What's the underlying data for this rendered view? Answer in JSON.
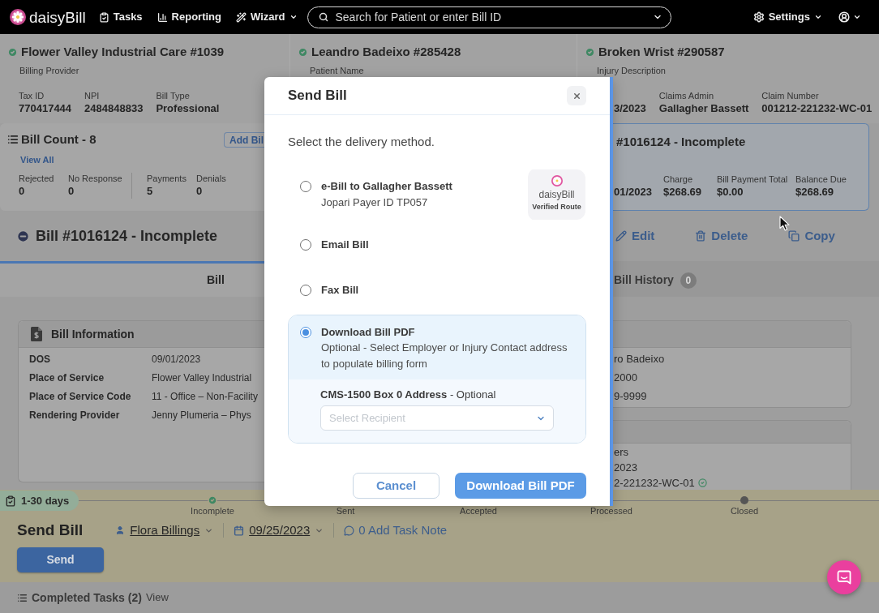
{
  "nav": {
    "logo": "daisy**Bill**",
    "items": [
      {
        "label": "Tasks",
        "menu": false
      },
      {
        "label": "Reporting",
        "menu": false
      },
      {
        "label": "Wizard",
        "menu": true
      }
    ],
    "search": {
      "placeholder": "Search for Patient or enter Bill ID"
    },
    "settings": {
      "label": "Settings",
      "menu": true
    },
    "account": {
      "menu": true
    }
  },
  "summary_cards": [
    {
      "title": "Flower Valley Industrial Care #1039",
      "subtitle": "Billing Provider",
      "fields": [
        {
          "label": "Tax ID",
          "value": "770417444"
        },
        {
          "label": "NPI",
          "value": "2484848833"
        },
        {
          "label": "Bill Type",
          "value": "Professional"
        }
      ]
    },
    {
      "title": "Leandro Badeixo #285428",
      "subtitle": "Patient Name"
    },
    {
      "title": "Broken Wrist #290587",
      "subtitle": "Injury Description",
      "fields": [
        {
          "value": "3/2023"
        },
        {
          "label": "Claims Admin",
          "value": "Gallagher Bassett"
        },
        {
          "label": "Claim Number",
          "value": "001212-221232-WC-01"
        }
      ]
    }
  ],
  "bill_count": {
    "title": "Bill Count - 8",
    "link": "View All",
    "add_button": "Add Bil",
    "stat_groups": [
      [
        {
          "label": "Rejected",
          "value": "0"
        },
        {
          "label": "No Response",
          "value": "0"
        }
      ],
      [
        {
          "label": "Payments",
          "value": "5"
        },
        {
          "label": "Denials",
          "value": "0"
        }
      ]
    ]
  },
  "selected_bill_card": {
    "title": "#1016124 - Incomplete",
    "highlighted": true,
    "fields": [
      {
        "value": "01/2023"
      },
      {
        "label": "Charge",
        "value": "$268.69"
      },
      {
        "label": "Bill Payment Total",
        "value": "$0.00"
      },
      {
        "label": "Balance Due",
        "value": "$268.69"
      }
    ]
  },
  "bill": {
    "title": "Bill #1016124 - Incomplete",
    "actions": [
      {
        "label": "Edit"
      },
      {
        "label": "Delete"
      },
      {
        "label": "Copy"
      }
    ]
  },
  "tabs": [
    {
      "label": "Bill",
      "selected": true
    },
    {
      "label": "Bill History",
      "count": "0",
      "selected": false
    }
  ],
  "bill_information": {
    "title": "Bill Information",
    "rows": [
      {
        "label": "DOS",
        "value": "09/01/2023"
      },
      {
        "label": "Place of Service",
        "value": "Flower Valley Industrial"
      },
      {
        "label": "Place of Service Code",
        "value": "11 - Office – Non-Facility"
      },
      {
        "label": "Rendering Provider",
        "value": "Jenny Plumeria – Phys"
      }
    ]
  },
  "side_cards": [
    {
      "lines": [
        {
          "text": "ro Badeixo",
          "verified": false
        },
        {
          "text": "2000",
          "verified": false
        },
        {
          "text": "9-9999",
          "verified": false
        }
      ]
    },
    {
      "lines": [
        {
          "text": "ers",
          "verified": false
        },
        {
          "text": "2023",
          "verified": false
        },
        {
          "text": "2-221232-WC-01",
          "verified": true
        }
      ]
    }
  ],
  "task": {
    "age": "1-30 days",
    "steps": [
      {
        "label": "Incomplete",
        "kind": "check"
      },
      {
        "label": "Sent",
        "kind": "plain"
      },
      {
        "label": "Accepted",
        "kind": "plain"
      },
      {
        "label": "Processed",
        "kind": "plain"
      },
      {
        "label": "Closed",
        "kind": "dot"
      }
    ],
    "title": "Send Bill",
    "assignee": "Flora Billings",
    "due_date": "09/25/2023",
    "note_link": "0 Add Task Note",
    "button": "Send"
  },
  "completed_tasks": {
    "label": "Completed Tasks (2)",
    "link": "View"
  },
  "modal": {
    "title": "Send Bill",
    "prompt": "Select the delivery method.",
    "options": [
      {
        "label": "e-Bill to Gallagher Bassett",
        "detail": "Jopari Payer ID TP057",
        "badge": {
          "logo": "daisy**Bill**",
          "caption": "Verified Route"
        },
        "selected": false
      },
      {
        "label": "Email Bill",
        "selected": false
      },
      {
        "label": "Fax Bill",
        "selected": false
      },
      {
        "label": "Download Bill PDF",
        "detail": "Optional - Select Employer or Injury Contact address to populate billing form",
        "selected": true,
        "field": {
          "label": "**CMS-1500 Box 0 Address** - Optional",
          "placeholder": "Select Recipient"
        }
      }
    ],
    "buttons": [
      {
        "label": "Cancel",
        "kind": "secondary"
      },
      {
        "label": "Download Bill PDF",
        "kind": "primary"
      }
    ]
  }
}
